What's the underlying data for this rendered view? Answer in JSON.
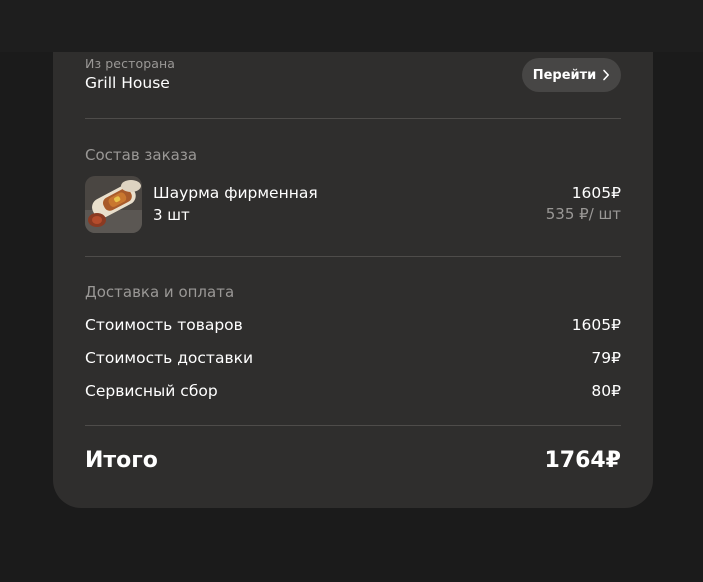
{
  "restaurant": {
    "caption": "Из ресторана",
    "name": "Grill House",
    "go_label": "Перейти",
    "go_icon": "chevron-right-icon"
  },
  "order": {
    "section_title": "Состав заказа",
    "items": [
      {
        "name": "Шаурма фирменная",
        "quantity": "3 шт",
        "price": "1605₽",
        "unit_price": "535 ₽/ шт",
        "image": "shawarma-photo"
      }
    ]
  },
  "payment": {
    "section_title": "Доставка и оплата",
    "lines": [
      {
        "label": "Стоимость товаров",
        "value": "1605₽"
      },
      {
        "label": "Стоимость доставки",
        "value": "79₽"
      },
      {
        "label": "Сервисный сбор",
        "value": "80₽"
      }
    ]
  },
  "total": {
    "label": "Итого",
    "value": "1764₽"
  },
  "colors": {
    "background": "#1b1b1b",
    "card": "#2f2e2d",
    "button": "#474645",
    "muted_text": "#9a9896",
    "divider": "#4e4c4a"
  }
}
